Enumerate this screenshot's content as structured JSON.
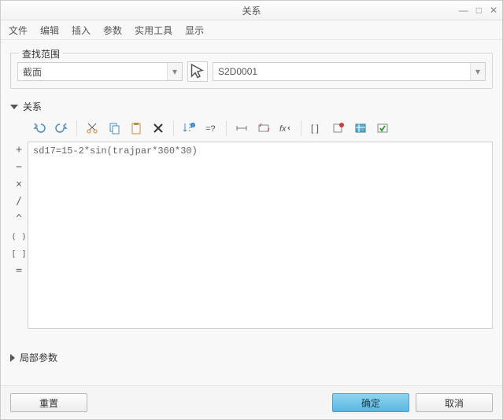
{
  "window": {
    "title": "关系"
  },
  "menu": {
    "file": "文件",
    "edit": "编辑",
    "insert": "插入",
    "params": "参数",
    "tools": "实用工具",
    "display": "显示"
  },
  "search_scope": {
    "legend": "查找范围",
    "dropdown1": "截面",
    "dropdown2": "S2D0001"
  },
  "relations": {
    "header": "关系",
    "code": "sd17=15-2*sin(trajpar*360*30)"
  },
  "gutter": {
    "plus": "+",
    "minus": "−",
    "mult": "×",
    "div": "/",
    "caret": "^",
    "paren": "( )",
    "brack": "[ ]",
    "eq": "="
  },
  "local_params": {
    "label": "局部参数"
  },
  "footer": {
    "reset": "重置",
    "ok": "确定",
    "cancel": "取消"
  },
  "fx": "fx"
}
